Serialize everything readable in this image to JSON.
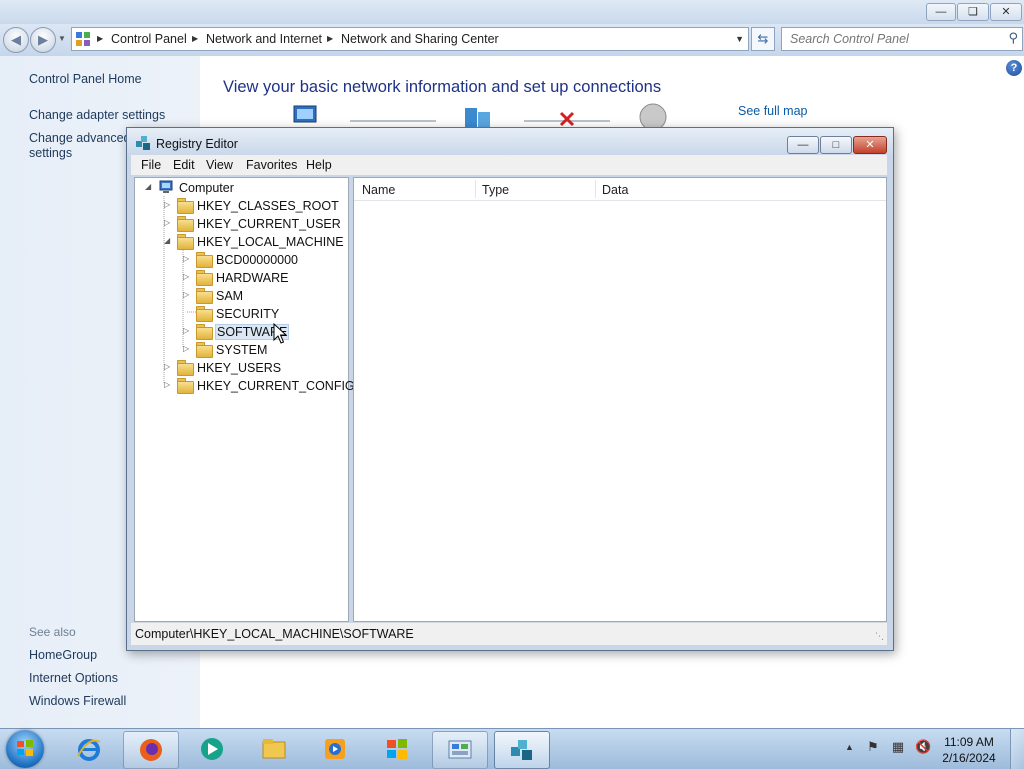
{
  "control_panel": {
    "breadcrumb": [
      "Control Panel",
      "Network and Internet",
      "Network and Sharing Center"
    ],
    "search_placeholder": "Search Control Panel",
    "sidebar": {
      "home": "Control Panel Home",
      "links": [
        "Change adapter settings",
        "Change advanced",
        "settings"
      ],
      "see_also_label": "See also",
      "see_also": [
        "HomeGroup",
        "Internet Options",
        "Windows Firewall"
      ]
    },
    "heading": "View your basic network information and set up connections",
    "see_full_map": "See full map"
  },
  "regedit": {
    "title": "Registry Editor",
    "menu": [
      "File",
      "Edit",
      "View",
      "Favorites",
      "Help"
    ],
    "tree": {
      "root": "Computer",
      "hives": [
        "HKEY_CLASSES_ROOT",
        "HKEY_CURRENT_USER",
        "HKEY_LOCAL_MACHINE",
        "HKEY_USERS",
        "HKEY_CURRENT_CONFIG"
      ],
      "hklm_children": [
        "BCD00000000",
        "HARDWARE",
        "SAM",
        "SECURITY",
        "SOFTWARE",
        "SYSTEM"
      ],
      "selected": "SOFTWARE"
    },
    "columns": [
      "Name",
      "Type",
      "Data"
    ],
    "status": "Computer\\HKEY_LOCAL_MACHINE\\SOFTWARE"
  },
  "taskbar": {
    "pinned": [
      "internet-explorer",
      "firefox",
      "media-app",
      "windows-explorer",
      "media-player",
      "windows-update",
      "control-panel",
      "registry-editor"
    ],
    "clock_time": "11:09 AM",
    "clock_date": "2/16/2024"
  },
  "colors": {
    "link": "#1e395b",
    "heading": "#1e3287",
    "close_red": "#c2412a",
    "selection": "#dbe7f4"
  }
}
